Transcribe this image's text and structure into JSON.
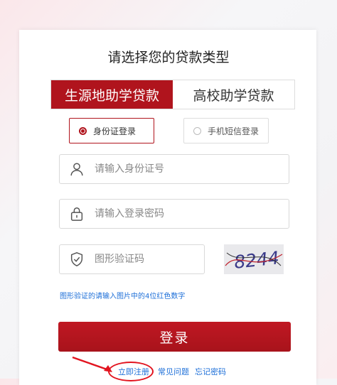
{
  "header": {
    "title": "请选择您的贷款类型"
  },
  "loan_types": [
    {
      "label": "生源地助学贷款"
    },
    {
      "label": "高校助学贷款"
    }
  ],
  "login_methods": [
    {
      "label": "身份证登录"
    },
    {
      "label": "手机短信登录"
    }
  ],
  "form": {
    "id_placeholder": "请输入身份证号",
    "password_placeholder": "请输入登录密码",
    "captcha_placeholder": "图形验证码",
    "captcha_text": "8244",
    "hint": "图形验证的请输入图片中的4位红色数字",
    "login_label": "登录"
  },
  "footer_links": {
    "register": "立即注册",
    "faq": "常见问题",
    "forgot": "忘记密码"
  },
  "colors": {
    "accent": "#b0141d",
    "link": "#1d6fd8"
  }
}
